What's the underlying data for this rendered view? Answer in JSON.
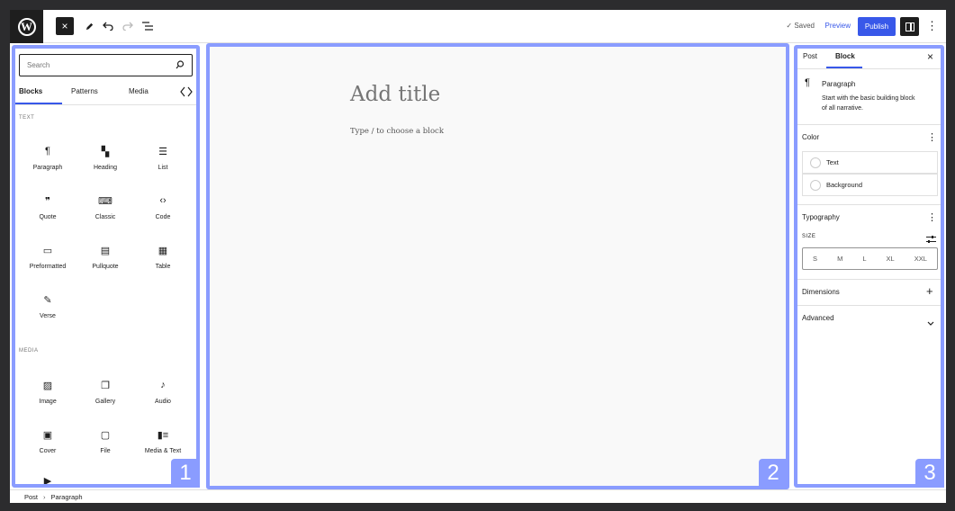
{
  "toolbar": {
    "logo_text": "W",
    "close_icon": "×",
    "saved_label": "✓ Saved",
    "preview_label": "Preview",
    "publish_label": "Publish",
    "more_icon": "⋮"
  },
  "inserter": {
    "search_placeholder": "Search",
    "tabs": [
      "Blocks",
      "Patterns",
      "Media"
    ],
    "sections": [
      {
        "heading": "TEXT",
        "blocks": [
          {
            "label": "Paragraph",
            "icon": "¶"
          },
          {
            "label": "Heading",
            "icon": "▚"
          },
          {
            "label": "List",
            "icon": "☰"
          },
          {
            "label": "Quote",
            "icon": "❞"
          },
          {
            "label": "Classic",
            "icon": "⌨"
          },
          {
            "label": "Code",
            "icon": "‹›"
          },
          {
            "label": "Preformatted",
            "icon": "▭"
          },
          {
            "label": "Pullquote",
            "icon": "▤"
          },
          {
            "label": "Table",
            "icon": "▦"
          },
          {
            "label": "Verse",
            "icon": "✎"
          }
        ]
      },
      {
        "heading": "MEDIA",
        "blocks": [
          {
            "label": "Image",
            "icon": "▨"
          },
          {
            "label": "Gallery",
            "icon": "❐"
          },
          {
            "label": "Audio",
            "icon": "♪"
          },
          {
            "label": "Cover",
            "icon": "▣"
          },
          {
            "label": "File",
            "icon": "▢"
          },
          {
            "label": "Media & Text",
            "icon": "▮≡"
          },
          {
            "label": "",
            "icon": "▶"
          }
        ]
      }
    ]
  },
  "canvas": {
    "title_placeholder": "Add title",
    "paragraph_placeholder": "Type / to choose a block"
  },
  "sidebar": {
    "tabs": [
      "Post",
      "Block"
    ],
    "close_icon": "×",
    "block_icon": "¶",
    "block_name": "Paragraph",
    "block_description_line1": "Start with the basic building block",
    "block_description_line2": "of all narrative.",
    "color_heading": "Color",
    "color_items": [
      "Text",
      "Background"
    ],
    "typography_heading": "Typography",
    "size_label": "SIZE",
    "sizes": [
      "S",
      "M",
      "L",
      "XL",
      "XXL"
    ],
    "dimensions_heading": "Dimensions",
    "advanced_heading": "Advanced"
  },
  "badges": [
    "1",
    "2",
    "3"
  ],
  "breadcrumb": [
    "Post",
    "Paragraph"
  ],
  "colors": {
    "accent": "#3858e9",
    "highlight_border": "#8a9cff",
    "frame": "#2c2c2e"
  }
}
